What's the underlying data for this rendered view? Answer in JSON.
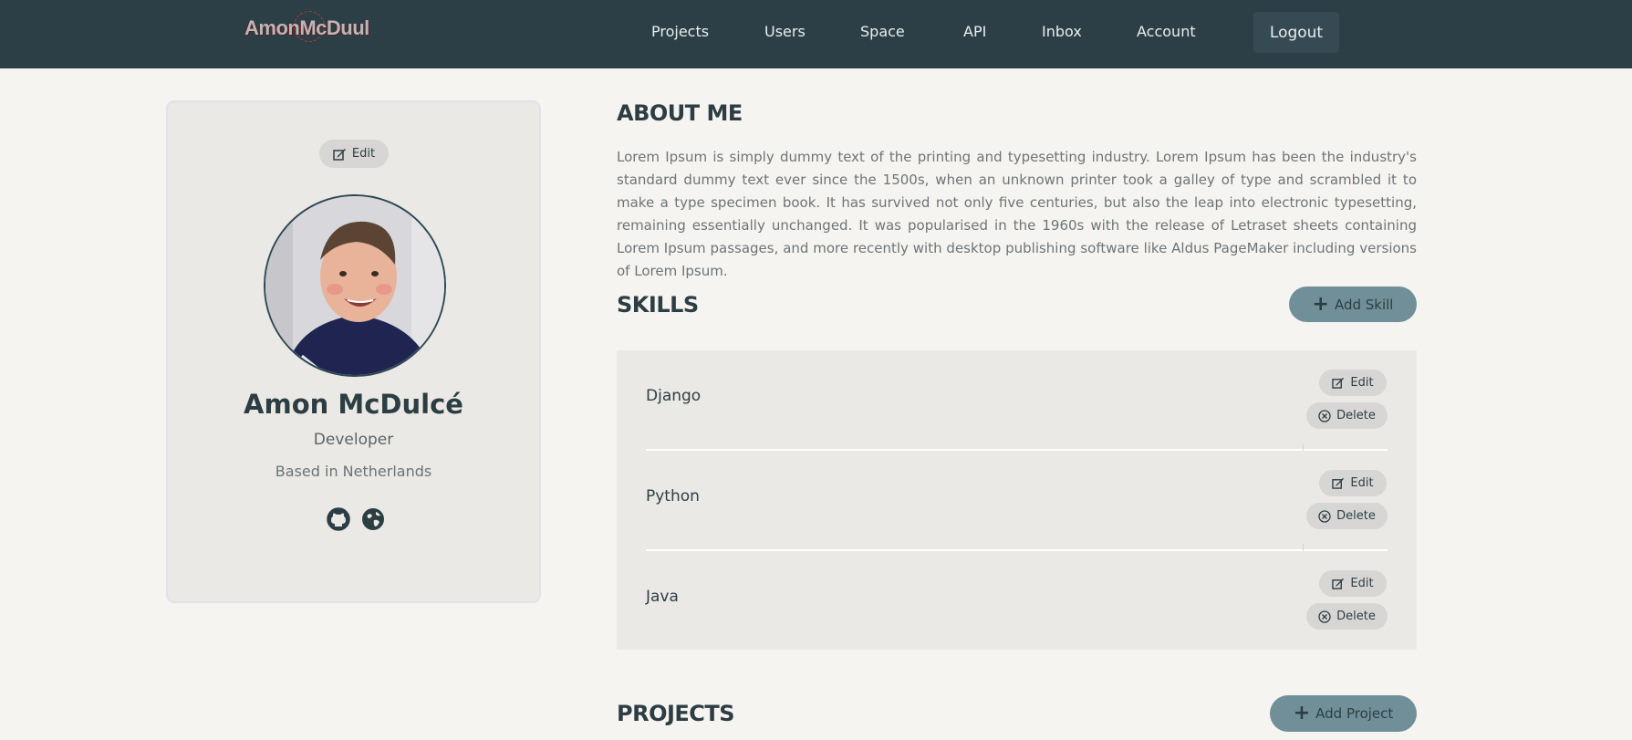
{
  "nav": {
    "logo": "AmonMcDuul",
    "links": [
      "Projects",
      "Users",
      "Space",
      "API",
      "Inbox",
      "Account"
    ],
    "logout_label": "Logout"
  },
  "profile": {
    "edit_label": "Edit",
    "name": "Amon McDulcé",
    "role": "Developer",
    "location": "Based in Netherlands",
    "social_icons": [
      "github-icon",
      "globe-icon"
    ]
  },
  "about": {
    "title": "ABOUT ME",
    "text": "Lorem Ipsum is simply dummy text of the printing and typesetting industry. Lorem Ipsum has been the industry's standard dummy text ever since the 1500s, when an unknown printer took a galley of type and scrambled it to make a type specimen book. It has survived not only five centuries, but also the leap into electronic typesetting, remaining essentially unchanged. It was popularised in the 1960s with the release of Letraset sheets containing Lorem Ipsum passages, and more recently with desktop publishing software like Aldus PageMaker including versions of Lorem Ipsum."
  },
  "skills": {
    "title": "SKILLS",
    "add_label": "Add Skill",
    "edit_label": "Edit",
    "delete_label": "Delete",
    "items": [
      {
        "name": "Django"
      },
      {
        "name": "Python"
      },
      {
        "name": "Java"
      }
    ]
  },
  "projects": {
    "title": "PROJECTS",
    "add_label": "Add Project"
  },
  "colors": {
    "nav_bg": "#2c3f46",
    "page_bg": "#f6f4f1",
    "card_bg": "#ebe9e6",
    "accent_button": "#718f99",
    "text_dark": "#2c3e44"
  }
}
